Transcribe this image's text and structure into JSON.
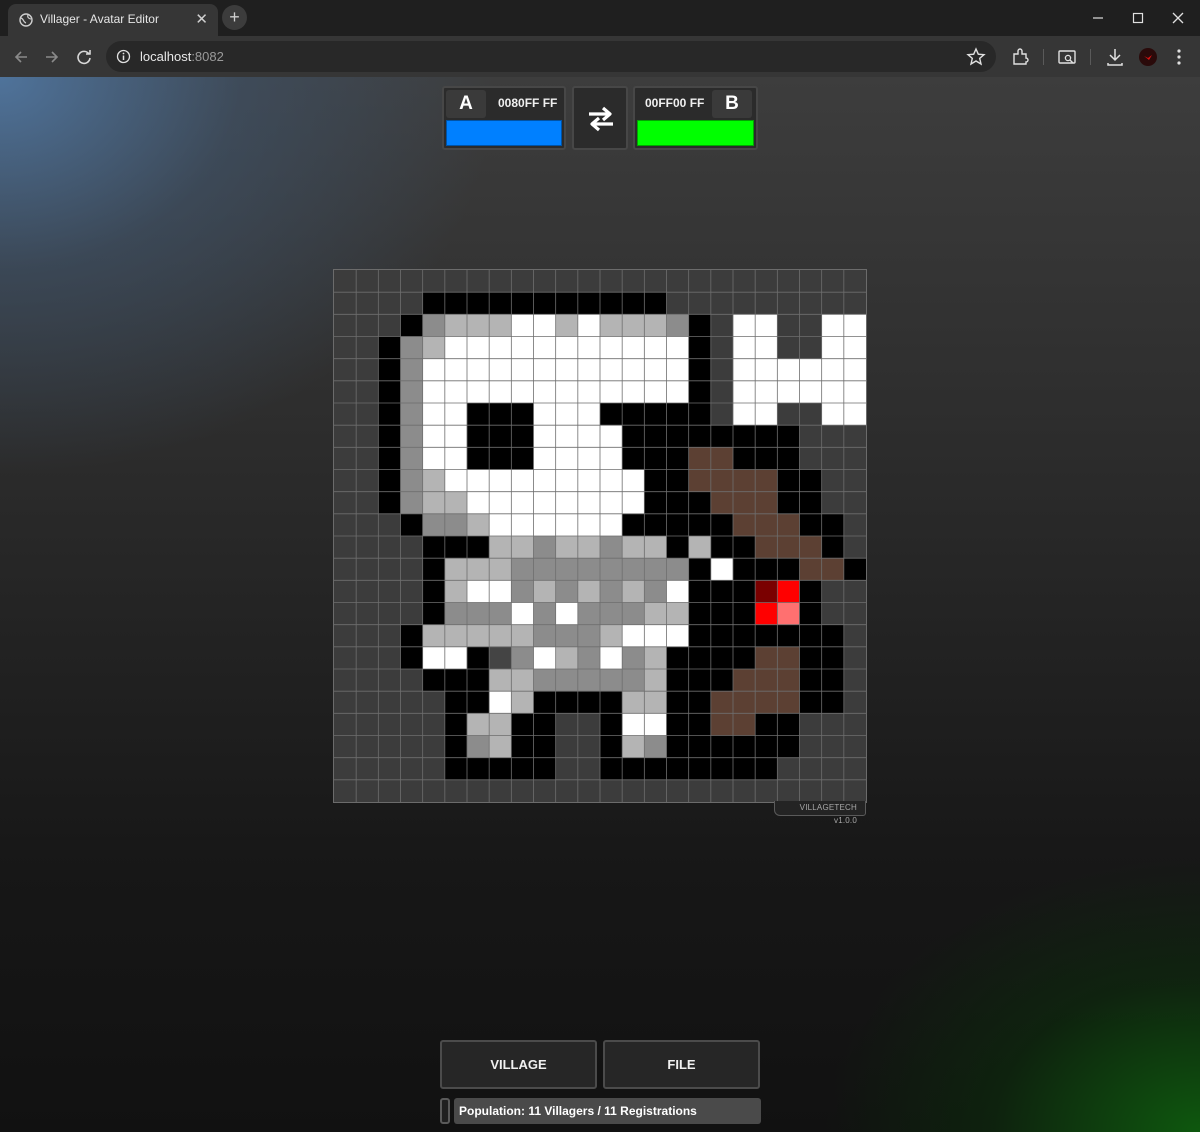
{
  "browser": {
    "tab_title": "Villager - Avatar Editor",
    "url_host": "localhost",
    "url_port": ":8082"
  },
  "colors": {
    "slot_a": {
      "letter": "A",
      "hex_label": "0080FF FF",
      "swatch": "#0080FF"
    },
    "slot_b": {
      "letter": "B",
      "hex_label": "00FF00 FF",
      "swatch": "#00FF00"
    }
  },
  "canvas": {
    "grid_size": 24,
    "version": "VILLAGETECH v1.0.0",
    "palette": {
      ".": "#3c3c3c",
      "K": "#000000",
      "W": "#ffffff",
      "L": "#b4b4b4",
      "M": "#8c8c8c",
      "D": "#444444",
      "N": "#5c4033",
      "R": "#7a0000",
      "r": "#ff0000",
      "p": "#ff7070"
    },
    "rows": [
      "........................",
      "....KKKKKKKKKKK.........",
      "...KMLLLWWLWLLLMK.WW..WW",
      "..KMLWWWWWWWWWWWK.WW..WW",
      "..KMWWWWWWWWWWWWK.WWWWWW",
      "..KMWWWWWWWWWWWWK.WWWWWW",
      "..KMWWKKKWWWKKKKK.WW..WW",
      "..KMWWKKKWWWWKKKKKKKK...",
      "..KMWWKKKWWWWKKKNNKKK...",
      "..KMLWWWWWWWWWKKNNNNKK..",
      "..KMLLWWWWWWWWKKKNNNKK..",
      "...KMMLWWWWWWKKKKKNNNKK.",
      "....KKKLLMLLMLLKLKKNNNK.",
      "....KLLLMMMMMMMMKWKKKNNK.",
      "....KLWWMLMLMLMWKKKRrK.",
      "....KMMMWMWMMMLLKKKrpK.",
      "...KLLLLLMMMLWWWKKKKKKK.",
      "...KWWKDMWLMWMLKKKKNNKK.",
      "....KKKLLMMMMMLKKKNNNKK.",
      ".....KKWLKKKKLLKKNNNNKK..",
      ".....KLLKK..KWWKKNNKK...",
      ".....KMLKK..KLMKKKKKK...",
      ".....KKKKK..KKKKKKKK....",
      "........................"
    ]
  },
  "menu": {
    "village_label": "VILLAGE",
    "file_label": "FILE"
  },
  "status": {
    "text": "Population: 11 Villagers / 11 Registrations"
  }
}
